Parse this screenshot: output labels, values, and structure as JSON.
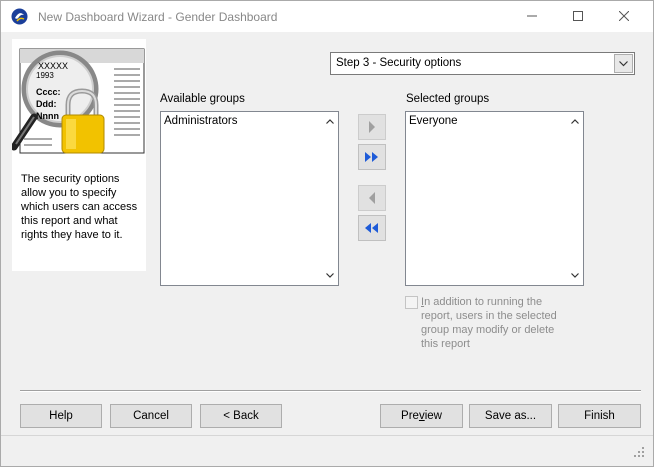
{
  "window": {
    "title": "New Dashboard Wizard - Gender Dashboard",
    "minimize_glyph": "—",
    "maximize_glyph": "☐",
    "close_glyph": "✕"
  },
  "left_panel": {
    "illustration_icon": "report-lock-magnifier-icon",
    "illustration_text": [
      "XXXXX",
      "1993",
      "Cccc:",
      "Ddd:",
      "Nnnn"
    ],
    "info_text": "The security options allow you to specify which users can access this report and what rights they have to it."
  },
  "step_select": {
    "value": "Step 3 - Security options"
  },
  "available_groups": {
    "label": "Available groups",
    "items": [
      "Administrators"
    ]
  },
  "selected_groups": {
    "label": "Selected groups",
    "items": [
      "Everyone"
    ]
  },
  "move_buttons": [
    {
      "name": "add-selected",
      "icon": "single-arrow-right-icon",
      "enabled": false
    },
    {
      "name": "add-all",
      "icon": "double-arrow-right-icon",
      "enabled": true
    },
    {
      "name": "remove-selected",
      "icon": "single-arrow-left-icon",
      "enabled": false
    },
    {
      "name": "remove-all",
      "icon": "double-arrow-left-icon",
      "enabled": true
    }
  ],
  "modify_option": {
    "checked": false,
    "enabled": false,
    "label_underlined_char": "I",
    "label_rest": "n addition to running the report, users in the selected group may modify or delete this report"
  },
  "buttons": {
    "help": "Help",
    "cancel": "Cancel",
    "back": "< Back",
    "preview_pre": "Pre",
    "preview_underlined": "v",
    "preview_post": "iew",
    "save_as": "Save as...",
    "finish": "Finish"
  },
  "colors": {
    "accent_blue": "#1e5bd8",
    "disabled_gray": "#8d8d8d",
    "lock_gold": "#f2c200"
  }
}
